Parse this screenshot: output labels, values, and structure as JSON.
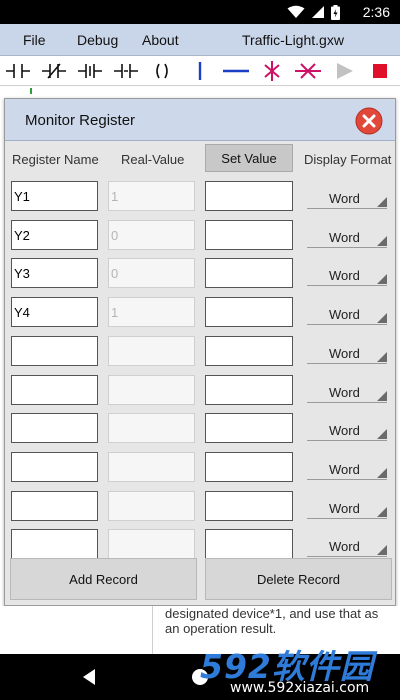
{
  "status_bar": {
    "time": "2:36"
  },
  "menu": {
    "items": [
      "File",
      "Debug",
      "About"
    ],
    "file_name": "Traffic-Light.gxw"
  },
  "toolbar": {
    "tools": [
      "no-contact-icon",
      "nc-contact-icon",
      "rising-edge-contact-icon",
      "falling-edge-contact-icon",
      "coil-icon",
      "vertical-line-icon",
      "horizontal-line-icon",
      "delete-vertical-line-icon",
      "delete-horizontal-line-icon",
      "run-icon",
      "stop-icon"
    ],
    "colors": {
      "contact": "#111111",
      "line": "#1a3fc4",
      "delete": "#cc1166",
      "run_disabled": "#c2c2c2",
      "stop": "#e0102a"
    }
  },
  "dialog": {
    "title": "Monitor Register",
    "headers": {
      "register_name": "Register Name",
      "real_value": "Real-Value",
      "set_value": "Set Value",
      "display_format": "Display Format"
    },
    "rows": [
      {
        "name": "Y1",
        "real": "1",
        "set": "",
        "format": "Word"
      },
      {
        "name": "Y2",
        "real": "0",
        "set": "",
        "format": "Word"
      },
      {
        "name": "Y3",
        "real": "0",
        "set": "",
        "format": "Word"
      },
      {
        "name": "Y4",
        "real": "1",
        "set": "",
        "format": "Word"
      },
      {
        "name": "",
        "real": "",
        "set": "",
        "format": "Word"
      },
      {
        "name": "",
        "real": "",
        "set": "",
        "format": "Word"
      },
      {
        "name": "",
        "real": "",
        "set": "",
        "format": "Word"
      },
      {
        "name": "",
        "real": "",
        "set": "",
        "format": "Word"
      },
      {
        "name": "",
        "real": "",
        "set": "",
        "format": "Word"
      },
      {
        "name": "",
        "real": "",
        "set": "",
        "format": "Word"
      }
    ],
    "add_record": "Add Record",
    "delete_record": "Delete Record"
  },
  "background_text": {
    "line1": "designated device*1, and use that as",
    "line2": "an operation result."
  },
  "watermark": {
    "brand": "592软件园",
    "url": "www.592xiazai.com"
  }
}
